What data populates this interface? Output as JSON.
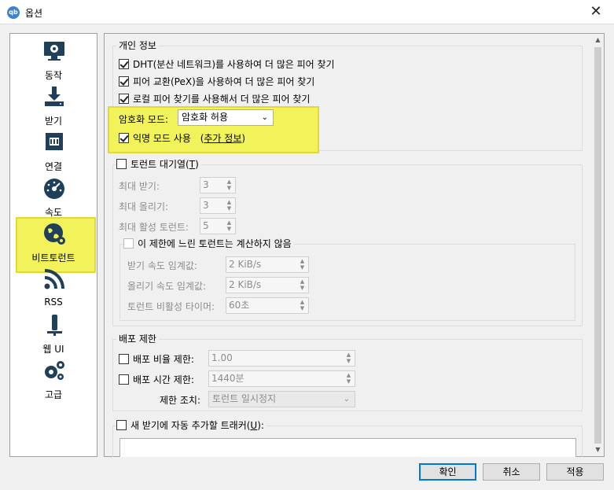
{
  "window": {
    "title": "옵션",
    "app_icon_text": "qb",
    "close_label": "✕"
  },
  "sidebar": {
    "items": [
      {
        "label": "동작",
        "icon": "monitor-gear-icon"
      },
      {
        "label": "받기",
        "icon": "download-icon"
      },
      {
        "label": "연결",
        "icon": "network-icon"
      },
      {
        "label": "속도",
        "icon": "speedometer-icon"
      },
      {
        "label": "비트토런트",
        "icon": "bittorrent-globe-gear-icon",
        "selected": true
      },
      {
        "label": "RSS",
        "icon": "rss-icon"
      },
      {
        "label": "웹 UI",
        "icon": "web-ui-icon"
      },
      {
        "label": "고급",
        "icon": "advanced-gears-icon"
      }
    ]
  },
  "privacy": {
    "title": "개인 정보",
    "dht": "DHT(분산 네트워크)를 사용하여 더 많은 피어 찾기",
    "pex": "피어 교환(PeX)을 사용하여 더 많은 피어 찾기",
    "lsd": "로컬 피어 찾기를 사용해서 더 많은 피어 찾기",
    "encryption_label": "암호화 모드:",
    "encryption_value": "암호화 허용",
    "anon_label": "익명 모드 사용",
    "anon_link_open": "(",
    "anon_link": "추가 정보",
    "anon_link_close": ")"
  },
  "queue": {
    "title": "토런트 대기열(",
    "title_key": "T",
    "title_close": ")",
    "max_down_label": "최대 받기:",
    "max_down_value": "3",
    "max_up_label": "최대 올리기:",
    "max_up_value": "3",
    "max_active_label": "최대 활성 토런트:",
    "max_active_value": "5",
    "slow_title": "이 제한에 느린 토런트는 계산하지 않음",
    "dl_threshold_label": "받기 속도 임계값:",
    "dl_threshold_value": "2 KiB/s",
    "ul_threshold_label": "올리기 속도 임계값:",
    "ul_threshold_value": "2 KiB/s",
    "inactive_timer_label": "토런트 비활성 타이머:",
    "inactive_timer_value": "60초"
  },
  "seeding": {
    "title": "배포 제한",
    "ratio_label": "배포 비율 제한:",
    "ratio_value": "1.00",
    "time_label": "배포 시간 제한:",
    "time_value": "1440분",
    "action_label": "제한 조치:",
    "action_value": "토런트 일시정지"
  },
  "trackers": {
    "label": "새 받기에 자동 추가할 트래커(",
    "label_key": "U",
    "label_close": "):"
  },
  "buttons": {
    "ok": "확인",
    "cancel": "취소",
    "apply": "적용"
  }
}
